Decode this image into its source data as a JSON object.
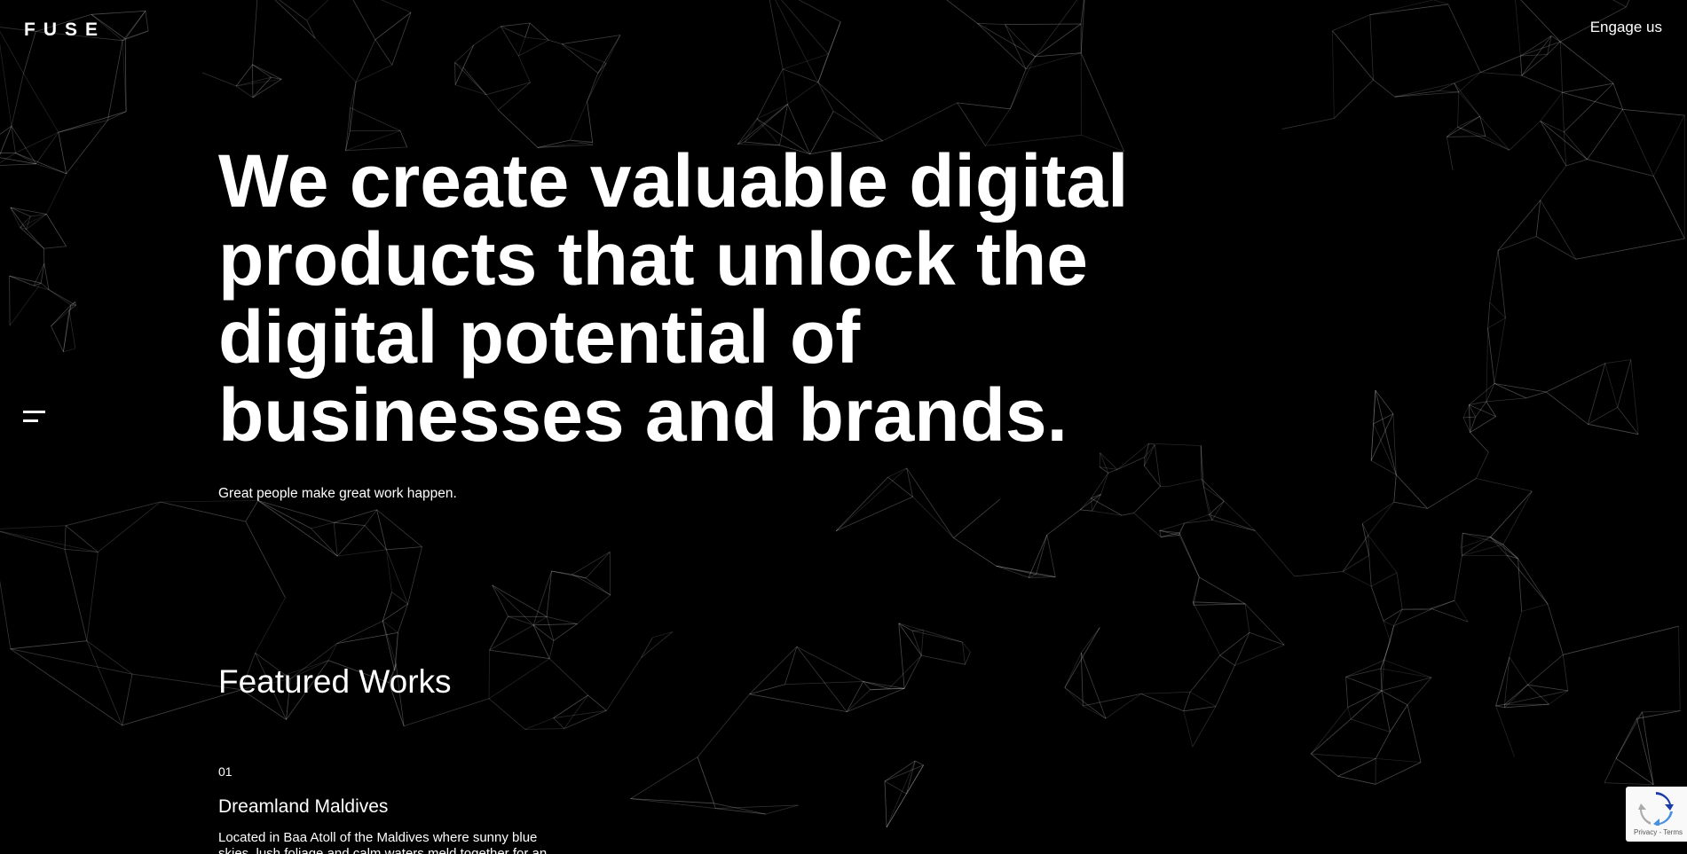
{
  "header": {
    "logo": "FUSE",
    "engage_label": "Engage us"
  },
  "hero": {
    "lines": [
      "We create valuable digital",
      "products that unlock the",
      "digital potential of",
      "businesses and brands."
    ],
    "tagline": "Great people make great work happen."
  },
  "featured": {
    "title": "Featured Works",
    "items": [
      {
        "number": "01",
        "title": "Dreamland Maldives",
        "description": "Located in Baa Atoll of the Maldives where sunny blue skies, lush foliage and calm waters meld together for an"
      }
    ]
  },
  "recaptcha": {
    "links": "Privacy - Terms"
  },
  "colors": {
    "background": "#000000",
    "text": "#ffffff",
    "mesh": "#ffffff"
  },
  "icons": {
    "menu": "hamburger-menu-icon",
    "recaptcha": "recaptcha-logo-icon"
  }
}
